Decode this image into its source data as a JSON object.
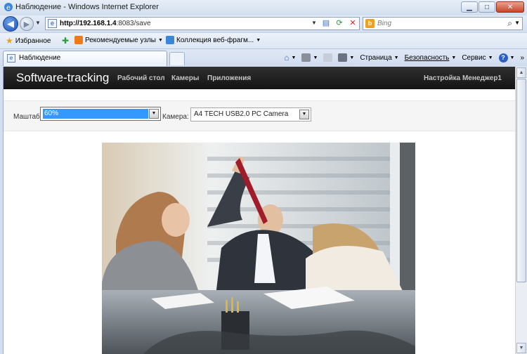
{
  "window": {
    "title": "Наблюдение - Windows Internet Explorer"
  },
  "address_bar": {
    "url_host": "http://192.168.1.4",
    "url_rest": ":8083/save"
  },
  "search": {
    "placeholder": "Bing"
  },
  "favorites_bar": {
    "favorites_label": "Избранное",
    "items": [
      {
        "label": "Рекомендуемые узлы"
      },
      {
        "label": "Коллекция веб-фрагм..."
      }
    ]
  },
  "tab": {
    "label": "Наблюдение"
  },
  "command_bar": {
    "page": "Страница",
    "safety": "Безопасность",
    "service": "Сервис"
  },
  "app": {
    "brand": "Software-tracking",
    "nav": [
      {
        "label": "Рабочий стол"
      },
      {
        "label": "Камеры"
      },
      {
        "label": "Приложения"
      }
    ],
    "nav_right": "Настройка Менеджер1"
  },
  "controls": {
    "zoom_label": "Маштаб:",
    "zoom_value": "60%",
    "camera_label": "Камера:",
    "camera_value": "A4 TECH USB2.0 PC Camera"
  },
  "colors": {
    "nav_bg": "#1d1d1d",
    "selection": "#3399ff",
    "ie_blue": "#1d53b5"
  }
}
